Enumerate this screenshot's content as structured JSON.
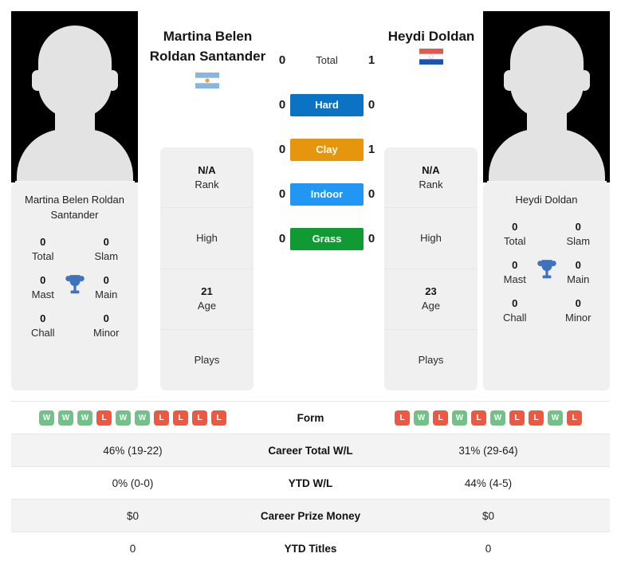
{
  "players": {
    "left": {
      "name_header": [
        "Martina Belen",
        "Roldan Santander"
      ],
      "card_name": [
        "Martina Belen Roldan",
        "Santander"
      ],
      "flag": "argentina-flag",
      "photo": "player-photo-placeholder",
      "titles": [
        {
          "value": "0",
          "label": "Total"
        },
        {
          "value": "0",
          "label": "Slam"
        },
        {
          "value": "0",
          "label": "Mast"
        },
        {
          "value": "0",
          "label": "Main"
        },
        {
          "value": "0",
          "label": "Chall"
        },
        {
          "value": "0",
          "label": "Minor"
        }
      ],
      "meta": [
        {
          "value": "N/A",
          "label": "Rank"
        },
        {
          "value": "",
          "label": "High"
        },
        {
          "value": "21",
          "label": "Age"
        },
        {
          "value": "",
          "label": "Plays"
        }
      ],
      "form": [
        "W",
        "W",
        "W",
        "L",
        "W",
        "W",
        "L",
        "L",
        "L",
        "L"
      ],
      "career_total_wl": "46% (19-22)",
      "ytd_wl": "0% (0-0)",
      "career_prize_money": "$0",
      "ytd_titles": "0"
    },
    "right": {
      "name_header": [
        "Heydi Doldan"
      ],
      "card_name": [
        "Heydi Doldan"
      ],
      "flag": "paraguay-flag",
      "photo": "player-photo-placeholder",
      "titles": [
        {
          "value": "0",
          "label": "Total"
        },
        {
          "value": "0",
          "label": "Slam"
        },
        {
          "value": "0",
          "label": "Mast"
        },
        {
          "value": "0",
          "label": "Main"
        },
        {
          "value": "0",
          "label": "Chall"
        },
        {
          "value": "0",
          "label": "Minor"
        }
      ],
      "meta": [
        {
          "value": "N/A",
          "label": "Rank"
        },
        {
          "value": "",
          "label": "High"
        },
        {
          "value": "23",
          "label": "Age"
        },
        {
          "value": "",
          "label": "Plays"
        }
      ],
      "form": [
        "L",
        "W",
        "L",
        "W",
        "L",
        "W",
        "L",
        "L",
        "W",
        "L"
      ],
      "career_total_wl": "31% (29-64)",
      "ytd_wl": "44% (4-5)",
      "career_prize_money": "$0",
      "ytd_titles": "0"
    }
  },
  "head_to_head": [
    {
      "label": "Total",
      "left": "0",
      "right": "1",
      "color": "",
      "plain": true
    },
    {
      "label": "Hard",
      "left": "0",
      "right": "0",
      "color": "#0b72c4",
      "plain": false
    },
    {
      "label": "Clay",
      "left": "0",
      "right": "1",
      "color": "#e5960c",
      "plain": false
    },
    {
      "label": "Indoor",
      "left": "0",
      "right": "0",
      "color": "#2196f3",
      "plain": false
    },
    {
      "label": "Grass",
      "left": "0",
      "right": "0",
      "color": "#119933",
      "plain": false
    }
  ],
  "table_labels": {
    "form": "Form",
    "career_total_wl": "Career Total W/L",
    "ytd_wl": "YTD W/L",
    "career_prize_money": "Career Prize Money",
    "ytd_titles": "YTD Titles"
  },
  "colors": {
    "win_badge": "#71c286",
    "loss_badge": "#ef5840",
    "card_bg": "#f0f0f0",
    "row_stripe": "#f3f3f3"
  }
}
